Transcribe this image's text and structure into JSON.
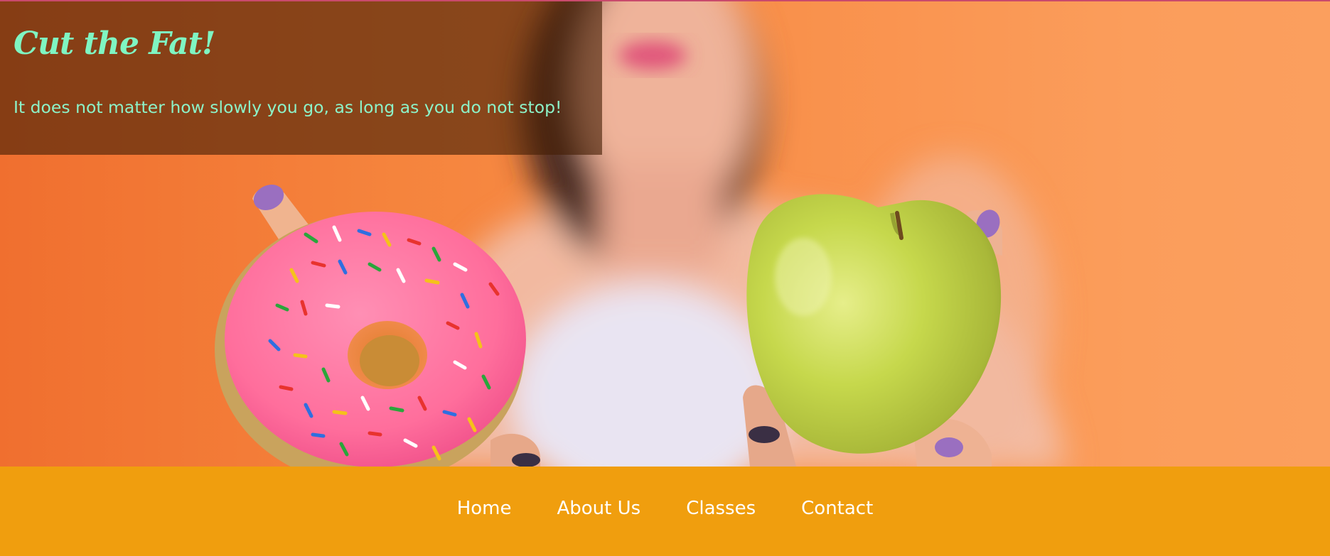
{
  "hero": {
    "title": "Cut the Fat!",
    "tagline": "It does not matter how slowly you go, as long as you do not stop!",
    "image_subject": "person-holding-donut-and-apple"
  },
  "nav": {
    "items": [
      {
        "label": "Home"
      },
      {
        "label": "About Us"
      },
      {
        "label": "Classes"
      },
      {
        "label": "Contact"
      }
    ]
  },
  "colors": {
    "title_text": "#7ff5c2",
    "banner_overlay": "rgba(70,30,5,0.62)",
    "hero_background": "#f5843d",
    "nav_background": "#f09e0e",
    "nav_text": "#ffffff",
    "top_rule": "#c94a6c"
  }
}
